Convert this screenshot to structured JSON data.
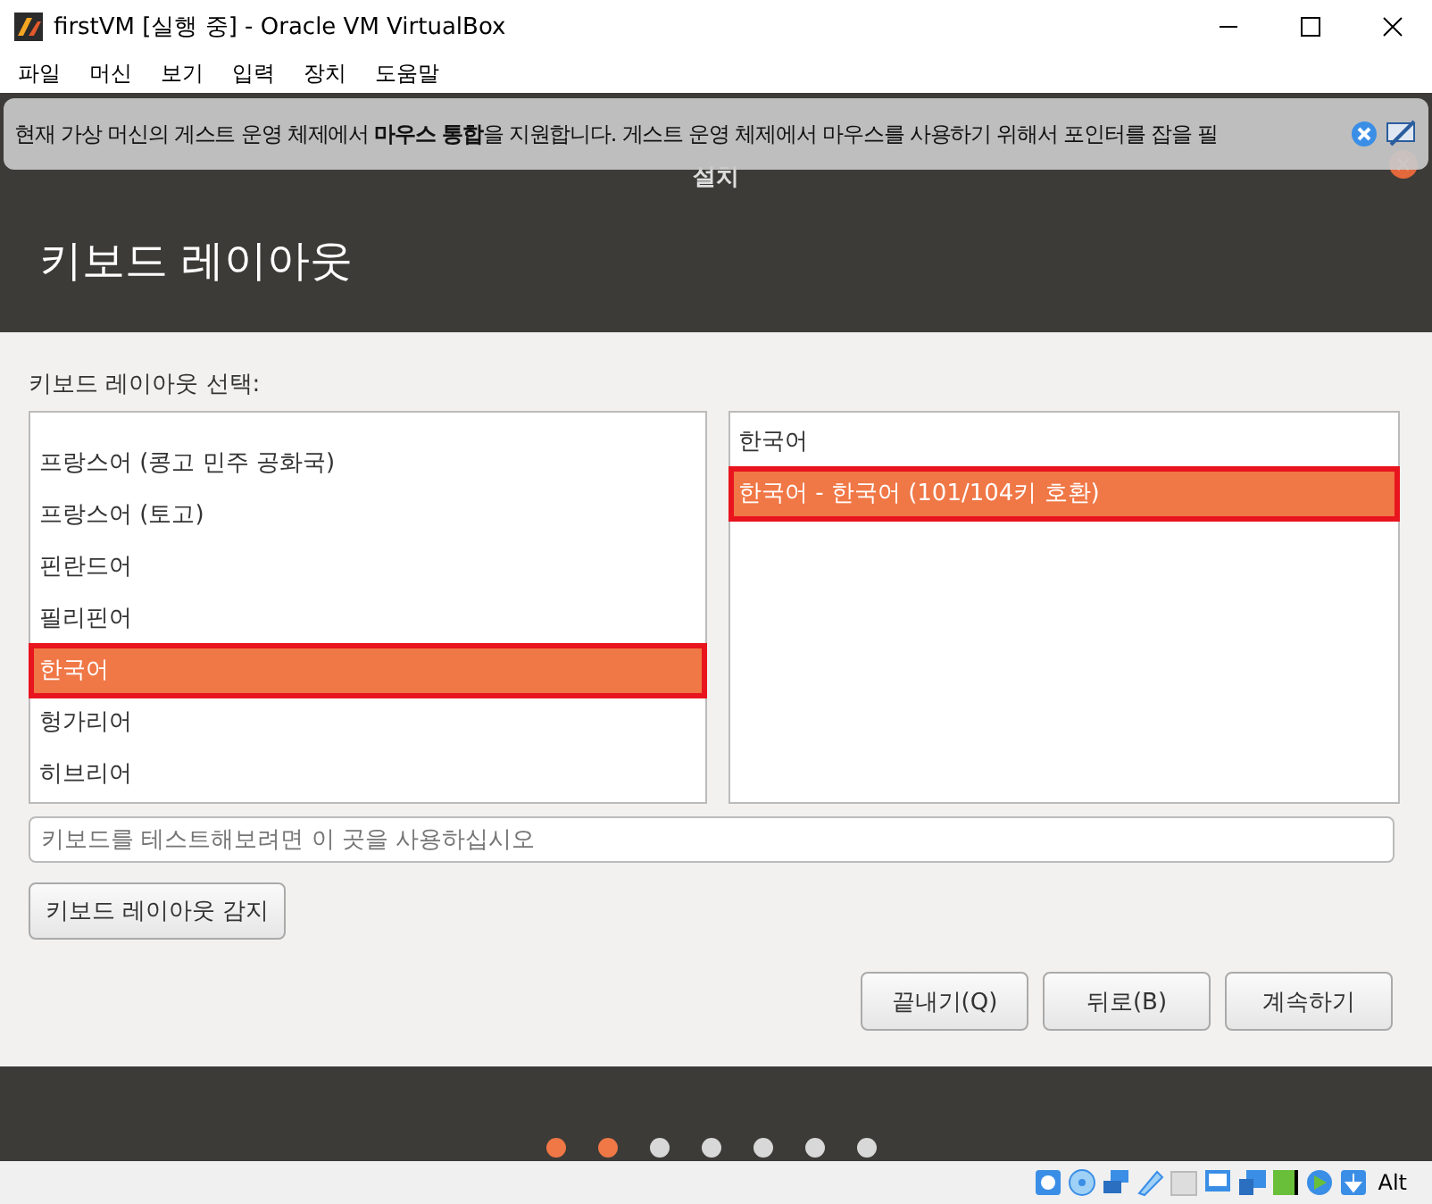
{
  "window": {
    "title": "firstVM [실행 중] - Oracle VM VirtualBox"
  },
  "menu": [
    "파일",
    "머신",
    "보기",
    "입력",
    "장치",
    "도움말"
  ],
  "notification": {
    "text": "현재 가상 머신의 게스트 운영 체제에서 **마우스 통합**을 지원합니다. 게스트 운영 체제에서 마우스를 사용하기 위해서 포인터를 잡을 필"
  },
  "installer": {
    "title": "설치",
    "heading": "키보드 레이아웃",
    "prompt": "키보드 레이아웃 선택:",
    "layouts": [
      {
        "label": "프랑스어 (콩고 민주 공화국)",
        "selected": false,
        "highlighted": false
      },
      {
        "label": "프랑스어 (토고)",
        "selected": false,
        "highlighted": false
      },
      {
        "label": "핀란드어",
        "selected": false,
        "highlighted": false
      },
      {
        "label": "필리핀어",
        "selected": false,
        "highlighted": false
      },
      {
        "label": "한국어",
        "selected": true,
        "highlighted": true
      },
      {
        "label": "헝가리어",
        "selected": false,
        "highlighted": false
      },
      {
        "label": "히브리어",
        "selected": false,
        "highlighted": false
      }
    ],
    "variants": [
      {
        "label": "한국어",
        "selected": false,
        "highlighted": false
      },
      {
        "label": "한국어 - 한국어 (101/104키 호환)",
        "selected": true,
        "highlighted": true
      }
    ],
    "test_field": {
      "placeholder": "키보드를 테스트해보려면 이 곳을 사용하십시오"
    },
    "detect_button": "키보드 레이아웃 감지",
    "buttons": [
      "끝내기(Q)",
      "뒤로(B)",
      "계속하기"
    ],
    "steps": [
      {
        "done": true
      },
      {
        "done": true
      },
      {
        "done": false
      },
      {
        "done": false
      },
      {
        "done": false
      },
      {
        "done": false
      },
      {
        "done": false
      }
    ]
  },
  "status_bar": {
    "key": "Alt"
  }
}
